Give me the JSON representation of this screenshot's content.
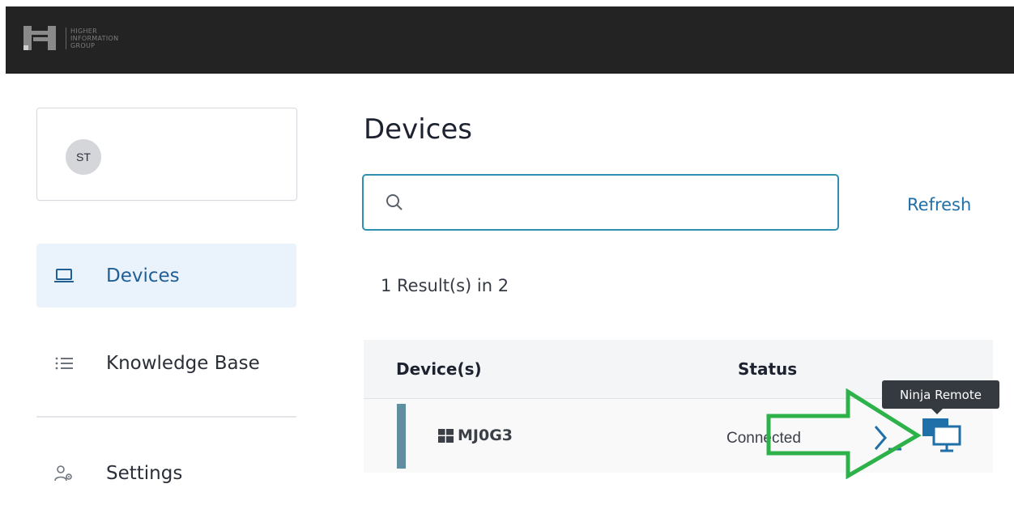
{
  "brand": {
    "logo_text_lines": [
      "HIGHER",
      "INFORMATION",
      "GROUP"
    ]
  },
  "user": {
    "initials": "ST"
  },
  "sidebar": {
    "items": [
      {
        "label": "Devices",
        "icon": "laptop-icon",
        "active": true
      },
      {
        "label": "Knowledge Base",
        "icon": "list-icon",
        "active": false
      },
      {
        "label": "Settings",
        "icon": "user-settings-icon",
        "active": false
      }
    ]
  },
  "main": {
    "title": "Devices",
    "search": {
      "value": "",
      "placeholder": ""
    },
    "refresh_label": "Refresh",
    "results_text": "1 Result(s) in 2"
  },
  "table": {
    "columns": [
      "Device(s)",
      "Status"
    ],
    "rows": [
      {
        "device": "MJ0G3",
        "os_icon": "windows-icon",
        "status": "Connected"
      }
    ]
  },
  "tooltip": {
    "text": "Ninja Remote"
  },
  "colors": {
    "accent": "#1f6fa8",
    "active_nav_bg": "#eaf2fb",
    "search_border": "#2e8fae",
    "row_accent": "#5e8ea0",
    "annotation_arrow": "#2db24a",
    "topbar": "#232323"
  }
}
